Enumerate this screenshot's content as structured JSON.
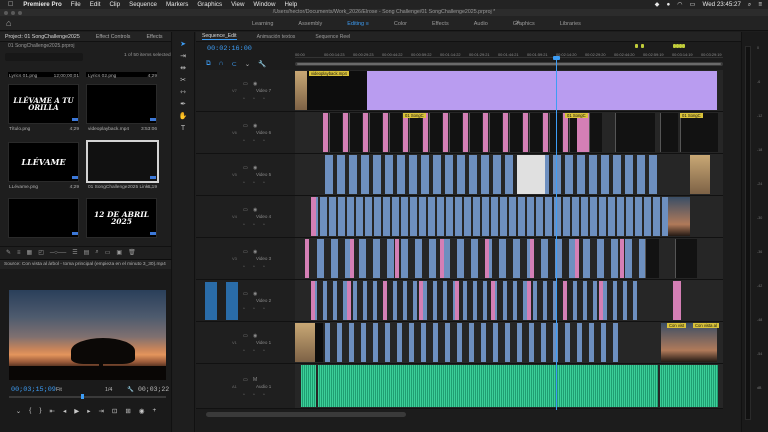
{
  "menubar": {
    "apple": "",
    "app": "Premiere Pro",
    "items": [
      "File",
      "Edit",
      "Clip",
      "Sequence",
      "Markers",
      "Graphics",
      "View",
      "Window",
      "Help"
    ],
    "clock": "Wed 23:45:27"
  },
  "titlebar": {
    "path": "/Users/hector/Documents/Work_2026/Elrose - Song Challenge/01 SongChallenge2025.prproj *"
  },
  "workspace": {
    "tabs": [
      "Learning",
      "Assembly",
      "Editing",
      "Color",
      "Effects",
      "Audio",
      "Graphics",
      "Libraries"
    ],
    "active": "Editing",
    "menu_glyph": "≡",
    "more": "»"
  },
  "project": {
    "tabs": [
      "Project: 01 SongChallenge2025",
      "Effect Controls",
      "Effects"
    ],
    "file": "01 SongChallenge2025.prproj",
    "selection": "1 of 50 items selected",
    "items": [
      {
        "name": "Lyrics 01.png",
        "dur": "12;00;00;01",
        "art": ""
      },
      {
        "name": "Lyrics 02.png",
        "dur": "4;29",
        "art": ""
      },
      {
        "name": "Título.png",
        "dur": "4;29",
        "art": "LLÉVAME A TU ORILLA"
      },
      {
        "name": "videoplayback.mp4",
        "dur": "3:53:06",
        "art": ""
      },
      {
        "name": "LLévame.png",
        "dur": "4;29",
        "art": "LLÉVAME"
      },
      {
        "name": "01 SongChallenge2025 Link...",
        "dur": "6;19",
        "art": ""
      },
      {
        "name": "",
        "dur": "",
        "art": ""
      },
      {
        "name": "",
        "dur": "",
        "art": "12 DE ABRIL 2025"
      }
    ]
  },
  "source": {
    "title": "Source: Con vista al árbol - toma principal (empieza en el minuto 3_30).mp4",
    "timecode": "00;03;15;09",
    "fit": "Fit",
    "ratio": "1/4",
    "duration": "00;03;22"
  },
  "timeline": {
    "tabs": [
      "Sequence_Edit",
      "Animación textos",
      "Sequence Reel"
    ],
    "timecode": "00:02:16:00",
    "ruler": [
      "00:00",
      "00:00:14:23",
      "00:00:29:23",
      "00:00:44:22",
      "00:00:59:22",
      "00:01:14:22",
      "00:01:29:21",
      "00:01:44:21",
      "00:01:59:21",
      "00:02:14:20",
      "00:02:29:20",
      "00:02:44:20",
      "00:02:59:19",
      "00:03:14:19",
      "00:03:29:19"
    ],
    "tracks": [
      {
        "code": "V7",
        "name": "Video 7"
      },
      {
        "code": "V6",
        "name": "Video 6"
      },
      {
        "code": "V5",
        "name": "Video 5"
      },
      {
        "code": "V4",
        "name": "Video 4"
      },
      {
        "code": "V3",
        "name": "Video 3"
      },
      {
        "code": "V2",
        "name": "Video 2"
      },
      {
        "code": "V1",
        "name": "Video 1"
      },
      {
        "code": "A1",
        "name": "Audio 1"
      }
    ],
    "clip_labels": {
      "v7": "videoplayback.mp4",
      "v6a": "01 SongC",
      "v6b": "01 SongC",
      "v1a": "Con vist",
      "v1b": "Con vista al"
    }
  },
  "meters": {
    "db": [
      "0",
      "-6",
      "-12",
      "-18",
      "-24",
      "-30",
      "-36",
      "-42",
      "-48",
      "-54",
      "dB"
    ]
  }
}
